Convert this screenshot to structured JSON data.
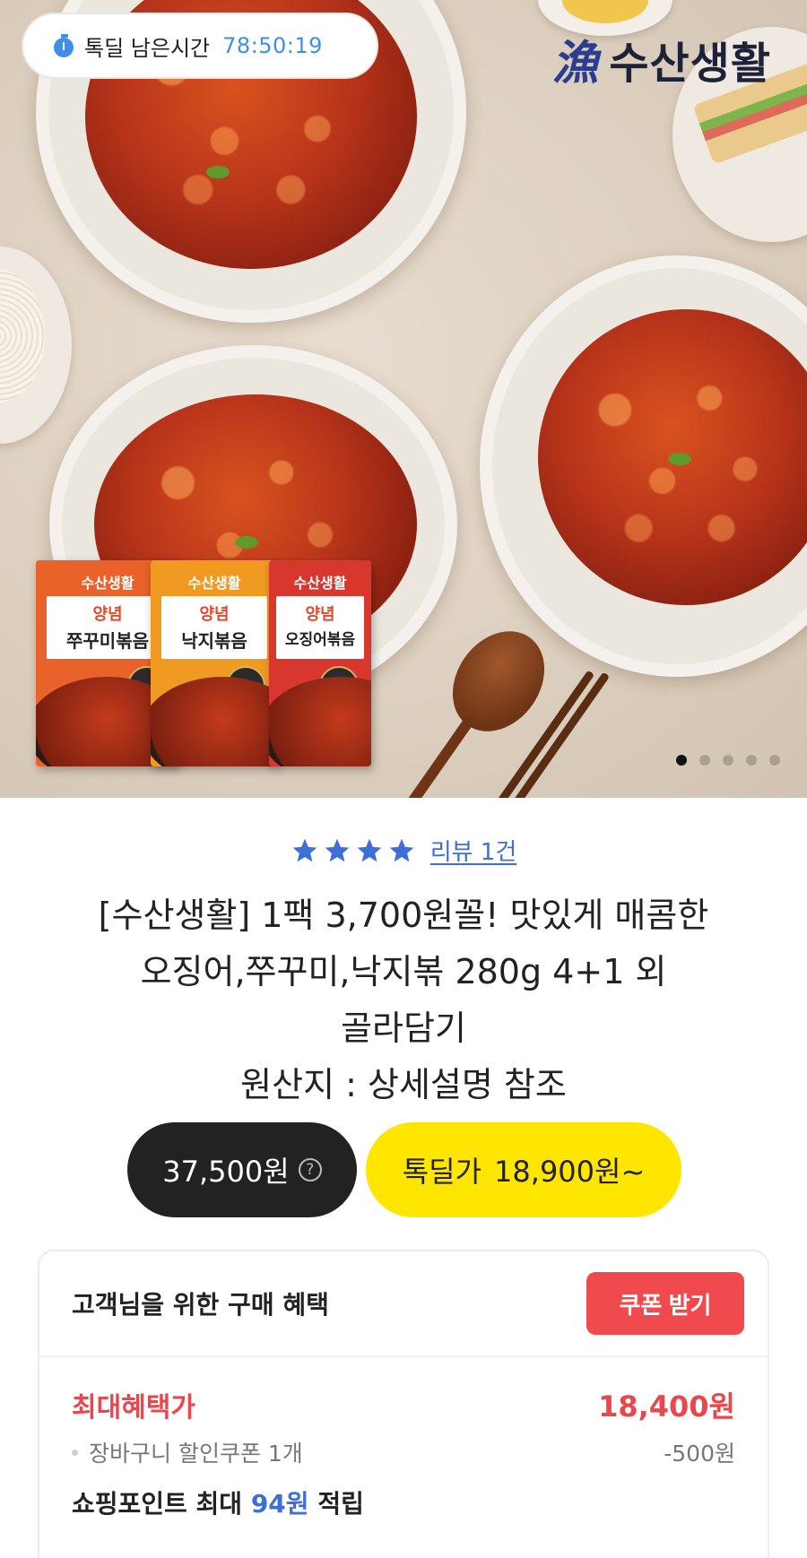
{
  "hero": {
    "timer_label": "톡딜 남은시간",
    "timer_value": "78:50:19",
    "brand_name": "수산생활",
    "brand_mark": "漁",
    "packs": [
      {
        "brand": "수산생활",
        "top": "양념",
        "main": "쭈꾸미볶음",
        "color": "#e9622a"
      },
      {
        "brand": "수산생활",
        "top": "양념",
        "main": "낙지볶음",
        "color": "#f09a21"
      },
      {
        "brand": "수산생활",
        "top": "양념",
        "main": "오징어볶음",
        "color": "#d8372e"
      }
    ],
    "slide_count": 5,
    "active_slide": 1
  },
  "product": {
    "review_link": "리뷰 1건",
    "rating_stars": 4,
    "title_line1": "[수산생활] 1팩 3,700원꼴! 맛있게 매콤한",
    "title_line2": "오징어,쭈꾸미,낙지볶 280g 4+1 외",
    "title_line3": "골라담기",
    "origin": "원산지 : 상세설명 참조",
    "original_price": "37,500원",
    "help_glyph": "?",
    "deal_label": "톡딜가",
    "deal_price": "18,900원~"
  },
  "benefits": {
    "title": "고객님을 위한 구매 혜택",
    "coupon_button": "쿠폰 받기",
    "max_label": "최대혜택가",
    "max_value": "18,400원",
    "coupon_label": "장바구니 할인쿠폰 1개",
    "coupon_value": "-500원",
    "point_prefix": "쇼핑포인트 최대",
    "point_value": "94원",
    "point_suffix": "적립"
  },
  "colors": {
    "accent_blue": "#3f8fe6",
    "deal_yellow": "#ffe600",
    "coupon_red": "#f0494e",
    "star_blue": "#3d6fd6"
  }
}
